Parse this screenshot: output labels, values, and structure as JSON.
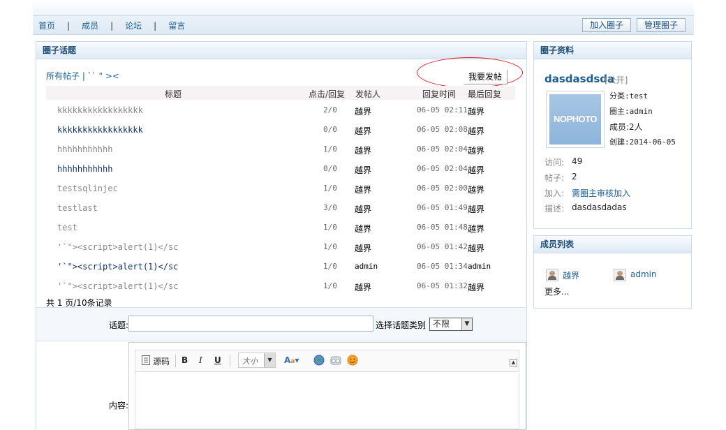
{
  "nav": {
    "links": [
      "首页",
      "成员",
      "论坛",
      "留言"
    ],
    "separator": "|",
    "join_button": "加入圈子",
    "manage_button": "管理圈子"
  },
  "topics_panel": {
    "title": "圈子话题",
    "filter": "所有帖子 | `` \" ><",
    "post_button": "我要发帖",
    "columns": {
      "title": "标题",
      "counts": "点击/回复",
      "poster": "发帖人",
      "reply_time": "回复时间",
      "last_reply": "最后回复"
    },
    "rows": [
      {
        "title": "kkkkkkkkkkkkkkkkk",
        "bold": false,
        "counts": "2/0",
        "poster": "越界",
        "time": "06-05 02:11",
        "last": "越界"
      },
      {
        "title": "kkkkkkkkkkkkkkkkk",
        "bold": true,
        "counts": "0/0",
        "poster": "越界",
        "time": "06-05 02:08",
        "last": "越界"
      },
      {
        "title": "hhhhhhhhhhh",
        "bold": false,
        "counts": "1/0",
        "poster": "越界",
        "time": "06-05 02:04",
        "last": "越界"
      },
      {
        "title": "hhhhhhhhhhh",
        "bold": true,
        "counts": "0/0",
        "poster": "越界",
        "time": "06-05 02:04",
        "last": "越界"
      },
      {
        "title": "testsqlinjec",
        "bold": false,
        "counts": "1/0",
        "poster": "越界",
        "time": "06-05 02:00",
        "last": "越界"
      },
      {
        "title": "testlast",
        "bold": false,
        "counts": "3/0",
        "poster": "越界",
        "time": "06-05 01:49",
        "last": "越界"
      },
      {
        "title": "test",
        "bold": false,
        "counts": "1/0",
        "poster": "越界",
        "time": "06-05 01:48",
        "last": "越界"
      },
      {
        "title": "'`\"><script>alert(1)</sc",
        "bold": false,
        "counts": "1/0",
        "poster": "越界",
        "time": "06-05 01:42",
        "last": "越界"
      },
      {
        "title": "'`\"><script>alert(1)</sc",
        "bold": true,
        "counts": "1/0",
        "poster": "admin",
        "time": "06-05 01:34",
        "last": "admin"
      },
      {
        "title": "'`\"><script>alert(1)</sc",
        "bold": false,
        "counts": "1/0",
        "poster": "越界",
        "time": "06-05 01:32",
        "last": "越界"
      }
    ],
    "record_count": "共 1 页/10条记录"
  },
  "form": {
    "topic_label": "话题:",
    "topic_value": "",
    "category_label": "选择话题类别",
    "category_value": "不限",
    "content_label": "内容:",
    "toolbar": {
      "source": "源码",
      "bold": "B",
      "italic": "I",
      "underline": "U",
      "size": "大小"
    }
  },
  "circle_panel": {
    "title": "圈子资料",
    "name": "dasdasdsda",
    "visibility": "[公开]",
    "photo_text": "NOPHOTO",
    "category": "分类:test",
    "owner": "圈主:admin",
    "members": "成员:2人",
    "created": "创建:2014-06-05",
    "visits_label": "访问:",
    "visits": "49",
    "posts_label": "帖子:",
    "posts": "2",
    "join_label": "加入:",
    "join_value": "需圈主审核加入",
    "desc_label": "描述:",
    "desc": "dasdasdadas"
  },
  "members_panel": {
    "title": "成员列表",
    "members": [
      "越界",
      "admin"
    ],
    "more": "更多..."
  }
}
